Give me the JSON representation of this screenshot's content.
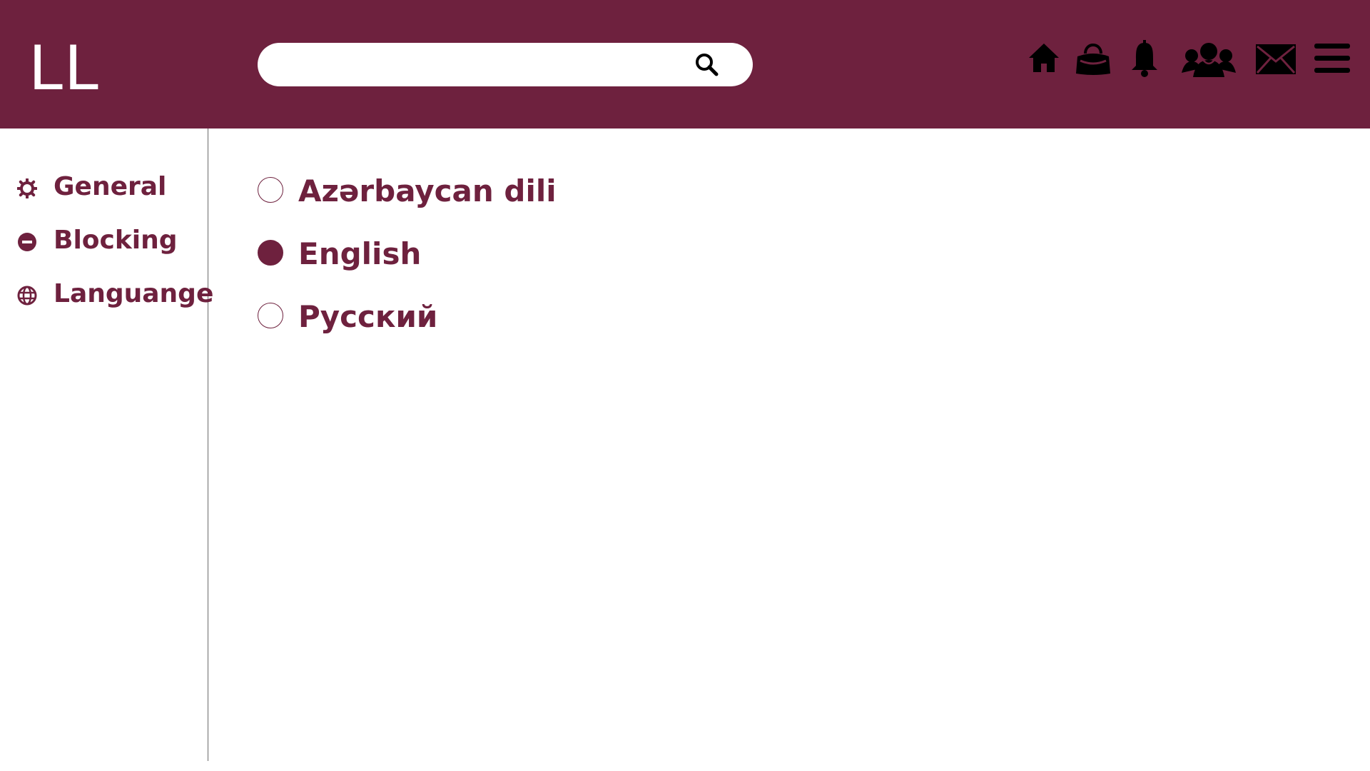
{
  "header": {
    "logo": "LL",
    "background_color": "#6e213e",
    "search": {
      "value": "",
      "placeholder": "",
      "button_icon": "search-icon"
    },
    "nav_icons": [
      "home-icon",
      "handbag-icon",
      "bell-icon",
      "friends-icon",
      "mail-icon",
      "menu-icon"
    ]
  },
  "sidebar": {
    "items": [
      {
        "label": "General",
        "icon": "gear-icon"
      },
      {
        "label": "Blocking",
        "icon": "block-icon"
      },
      {
        "label": "Languange",
        "icon": "globe-icon"
      }
    ]
  },
  "language": {
    "options": [
      {
        "label": "Azərbaycan dili",
        "selected": false
      },
      {
        "label": "English",
        "selected": true
      },
      {
        "label": "Русский",
        "selected": false
      }
    ]
  },
  "colors": {
    "accent": "#6e213e",
    "icon": "#000000",
    "divider": "#6a6a6a"
  }
}
